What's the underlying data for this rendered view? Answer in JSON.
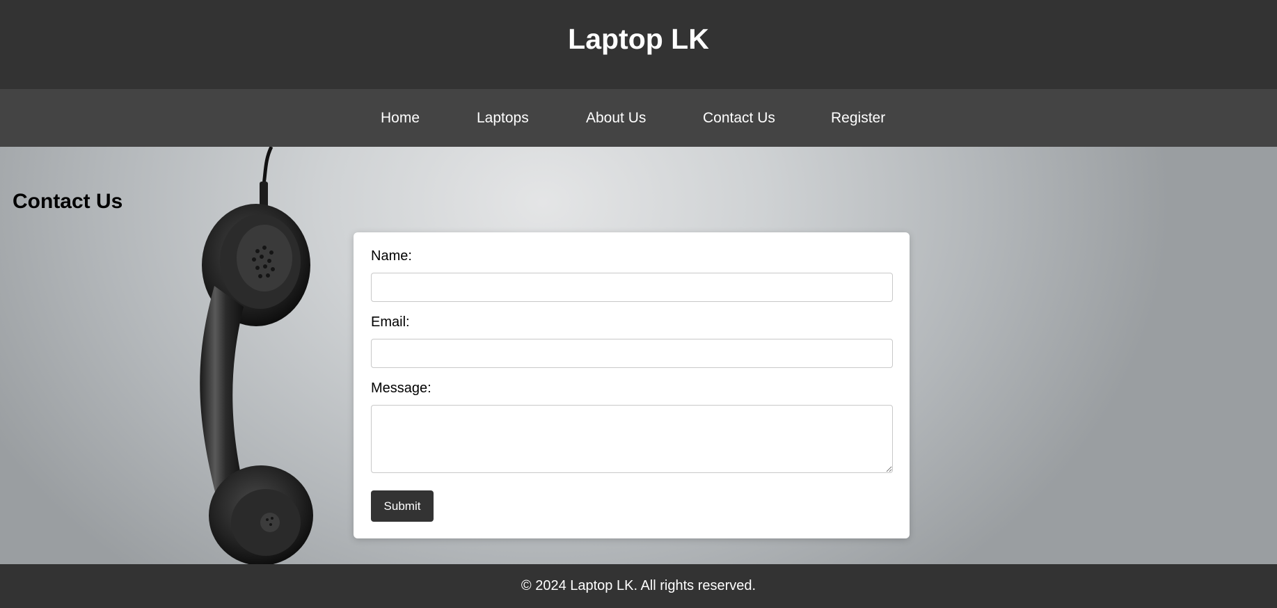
{
  "header": {
    "title": "Laptop LK"
  },
  "nav": {
    "items": [
      {
        "label": "Home"
      },
      {
        "label": "Laptops"
      },
      {
        "label": "About Us"
      },
      {
        "label": "Contact Us"
      },
      {
        "label": "Register"
      }
    ]
  },
  "main": {
    "heading": "Contact Us",
    "background_icon": "telephone-handset-icon",
    "form": {
      "name_label": "Name:",
      "name_value": "",
      "email_label": "Email:",
      "email_value": "",
      "message_label": "Message:",
      "message_value": "",
      "submit_label": "Submit"
    }
  },
  "footer": {
    "text": "© 2024 Laptop LK. All rights reserved."
  },
  "colors": {
    "header_bg": "#333333",
    "nav_bg": "#444444",
    "button_bg": "#333333",
    "text_light": "#ffffff"
  }
}
